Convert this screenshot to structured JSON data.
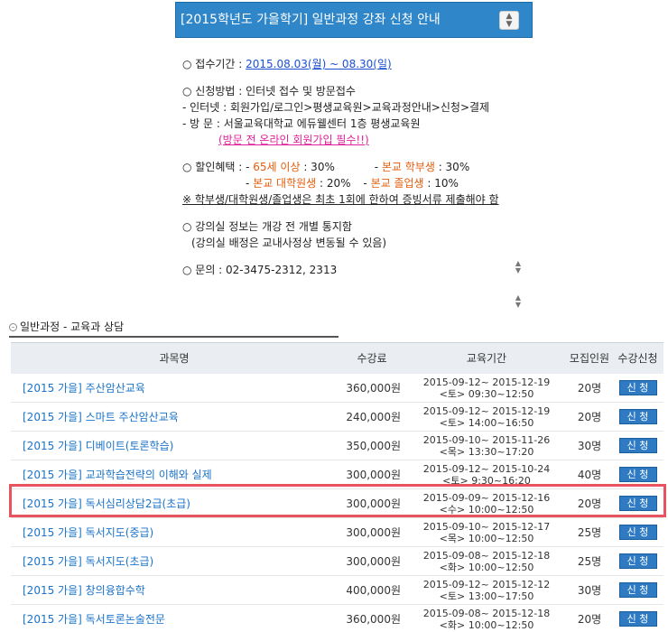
{
  "notice": {
    "title": "[2015학년도 가을학기] 일반과정 강좌 신청 안내",
    "period_label": "○ 접수기간 :",
    "period_value": "2015.08.03(월) ~ 08.30(일)",
    "method_label": "○ 신청방법 : 인터넷 접수 및 방문접수",
    "internet_line": "- 인터넷 : 회원가입/로그인>평생교육원>교육과정안내>신청>결제",
    "visit_line": "- 방 문 : 서울교육대학교 에듀웰센터 1층 평생교육원",
    "visit_note": "(방문 전 온라인 회원가입 필수!!)",
    "discount_label": "○ 할인혜택 : -",
    "senior": "65세 이상",
    "senior_rate": ": 30%",
    "undergrad": "본교 학부생",
    "undergrad_rate": ": 30%",
    "grad": "본교 대학원생",
    "grad_rate": ": 20%",
    "alumni": "본교 졸업생",
    "alumni_rate": ": 10%",
    "proof_note": "※ 학부생/대학원생/졸업생은 최초 1회에 한하여 증빙서류 제출해야 함",
    "room_line": "○ 강의실 정보는 개강 전 개별 통지함",
    "room_note": "(강의실 배정은 교내사정상 변동될 수 있음)",
    "contact_line": "○ 문의 : 02-3475-2312, 2313"
  },
  "section": {
    "title": "일반과정 - 교육과 상담"
  },
  "table": {
    "headers": [
      "과목명",
      "수강료",
      "교육기간",
      "모집인원",
      "수강신청"
    ],
    "apply_label": "신 청",
    "rows": [
      {
        "name": "[2015 가을] 주산암산교육",
        "fee": "360,000원",
        "period1": "2015-09-12~ 2015-12-19",
        "period2": "<토> 09:30~12:50",
        "capacity": "20명"
      },
      {
        "name": "[2015 가을] 스마트 주산암산교육",
        "fee": "240,000원",
        "period1": "2015-09-12~ 2015-12-19",
        "period2": "<토> 14:00~16:50",
        "capacity": "20명"
      },
      {
        "name": "[2015 가을] 디베이트(토론학습)",
        "fee": "350,000원",
        "period1": "2015-09-10~ 2015-11-26",
        "period2": "<목> 13:30~17:20",
        "capacity": "30명"
      },
      {
        "name": "[2015 가을] 교과학습전략의 이해와 실제",
        "fee": "300,000원",
        "period1": "2015-09-12~ 2015-10-24",
        "period2": "<토> 9:30~16:20",
        "capacity": "40명"
      },
      {
        "name": "[2015 가을] 독서심리상담2급(초급)",
        "fee": "300,000원",
        "period1": "2015-09-09~ 2015-12-16",
        "period2": "<수> 10:00~12:50",
        "capacity": "20명"
      },
      {
        "name": "[2015 가을] 독서지도(중급)",
        "fee": "300,000원",
        "period1": "2015-09-10~ 2015-12-17",
        "period2": "<목> 10:00~12:50",
        "capacity": "25명"
      },
      {
        "name": "[2015 가을] 독서지도(초급)",
        "fee": "300,000원",
        "period1": "2015-09-08~ 2015-12-18",
        "period2": "<화> 10:00~12:50",
        "capacity": "25명"
      },
      {
        "name": "[2015 가을] 창의융합수학",
        "fee": "400,000원",
        "period1": "2015-09-12~ 2015-12-12",
        "period2": "<토> 13:00~17:50",
        "capacity": "30명"
      },
      {
        "name": "[2015 가을] 독서토론논술전문",
        "fee": "360,000원",
        "period1": "2015-09-08~ 2015-12-18",
        "period2": "<화> 10:00~12:50",
        "capacity": "20명"
      }
    ]
  },
  "colors": {
    "accent": "#2f86c8",
    "link": "#1a73c9",
    "highlight": "#e8545e",
    "orange": "#e65e0e",
    "pink": "#e0229a"
  }
}
